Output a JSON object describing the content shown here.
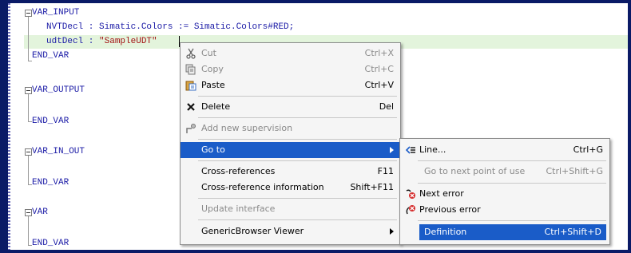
{
  "code": {
    "var_input": "VAR_INPUT",
    "nvt_decl": "NVTDecl : Simatic.Colors := Simatic.Colors#RED;",
    "udt_decl_name": "udtDecl : ",
    "udt_decl_type": "\"SampleUDT\"",
    "end_var_1": "END_VAR",
    "var_output": "VAR_OUTPUT",
    "end_var_2": "END_VAR",
    "var_in_out": "VAR_IN_OUT",
    "end_var_3": "END_VAR",
    "var": "VAR",
    "end_var_4": "END_VAR"
  },
  "context_menu": {
    "cut": {
      "label": "Cut",
      "shortcut": "Ctrl+X",
      "icon": "scissors-icon"
    },
    "copy": {
      "label": "Copy",
      "shortcut": "Ctrl+C",
      "icon": "copy-icon"
    },
    "paste": {
      "label": "Paste",
      "shortcut": "Ctrl+V",
      "icon": "paste-icon"
    },
    "delete": {
      "label": "Delete",
      "shortcut": "Del",
      "icon": "delete-x-icon"
    },
    "add_supervision": {
      "label": "Add new supervision",
      "icon": "supervision-icon"
    },
    "goto": {
      "label": "Go to"
    },
    "cross_refs": {
      "label": "Cross-references",
      "shortcut": "F11"
    },
    "cross_ref_info": {
      "label": "Cross-reference information",
      "shortcut": "Shift+F11"
    },
    "update_interface": {
      "label": "Update interface"
    },
    "generic_browser": {
      "label": "GenericBrowser Viewer"
    }
  },
  "submenu": {
    "line": {
      "label": "Line...",
      "shortcut": "Ctrl+G",
      "icon": "goto-line-icon"
    },
    "next_use": {
      "label": "Go to next point of use",
      "shortcut": "Ctrl+Shift+G"
    },
    "next_error": {
      "label": "Next error",
      "icon": "next-error-icon"
    },
    "prev_error": {
      "label": "Previous error",
      "icon": "previous-error-icon"
    },
    "definition": {
      "label": "Definition",
      "shortcut": "Ctrl+Shift+D"
    }
  },
  "colors": {
    "background": "#0a1a66",
    "selection": "#1a5cc8",
    "highlight_line": "#e3f4dc"
  }
}
